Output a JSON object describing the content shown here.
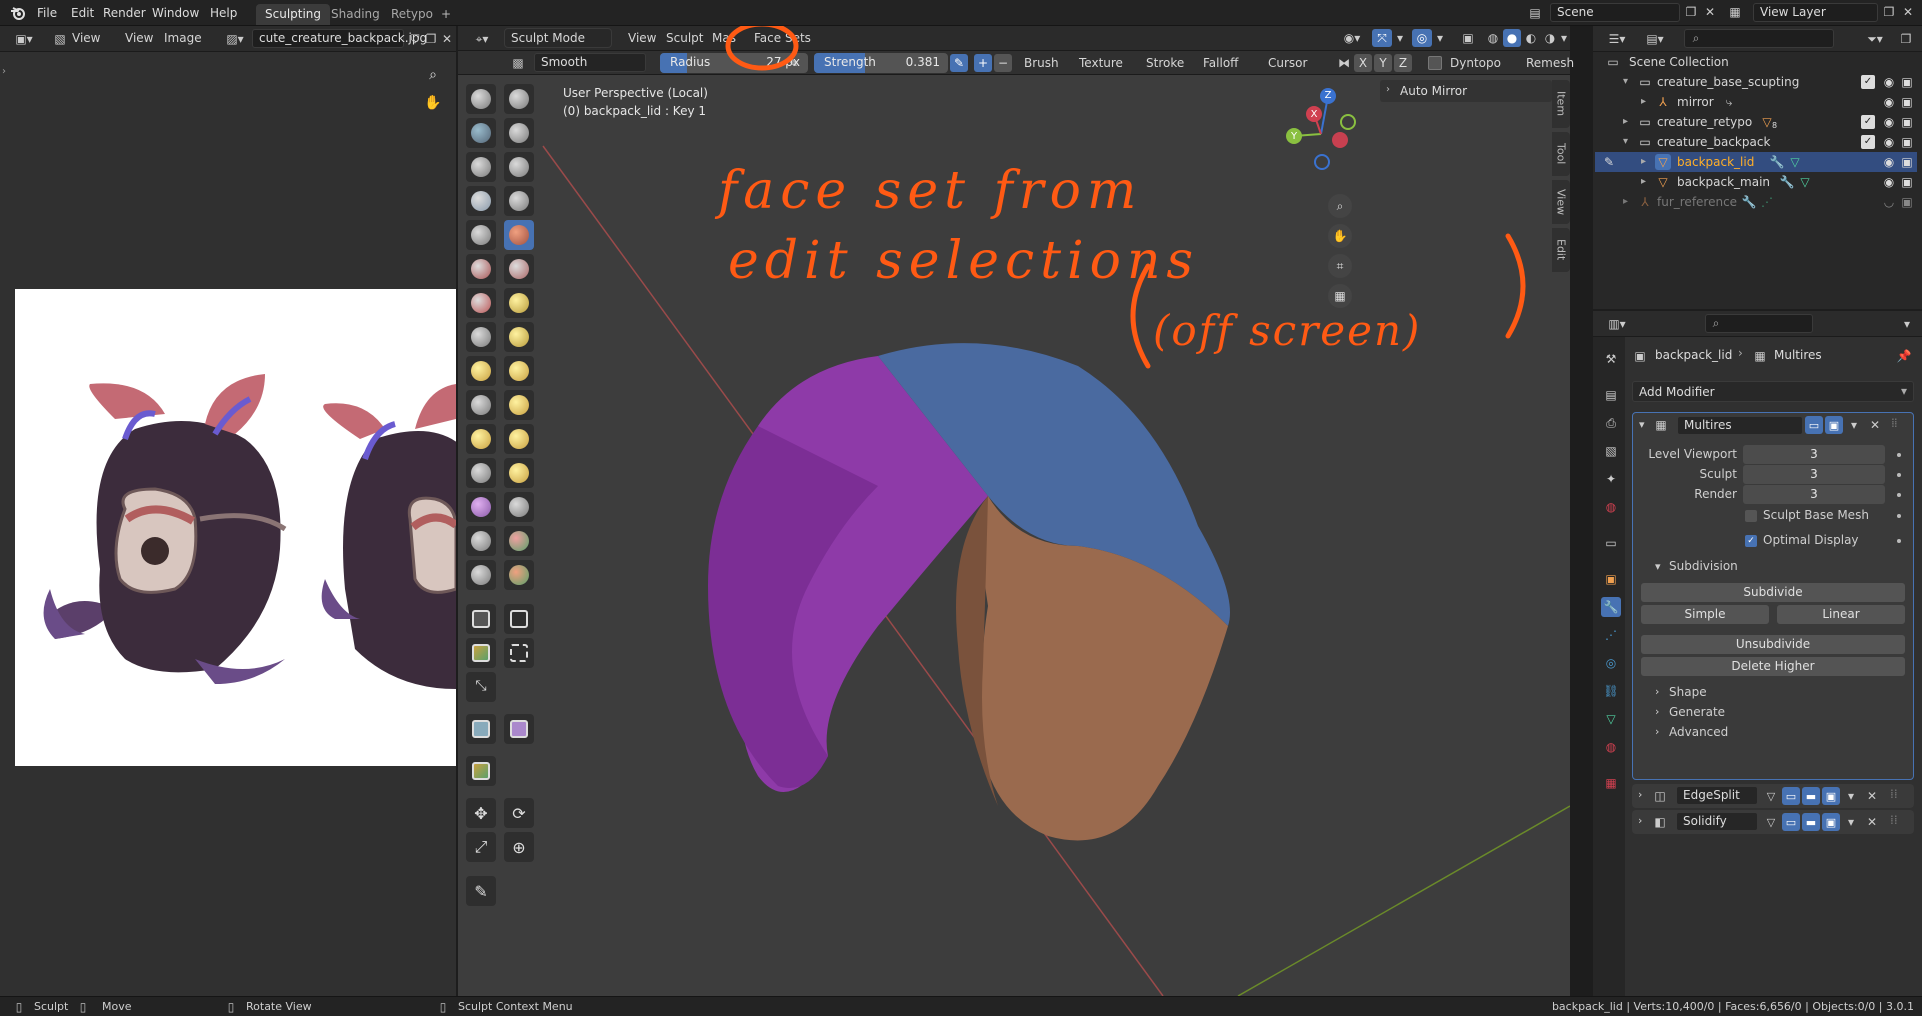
{
  "topbar": {
    "menus": [
      "File",
      "Edit",
      "Render",
      "Window",
      "Help"
    ],
    "workspaces": [
      "Sculpting",
      "Shading",
      "Retypo"
    ],
    "add_tab": "+",
    "scene_name": "Scene",
    "view_layer": "View Layer"
  },
  "image_editor": {
    "view_label": "View",
    "menus": [
      "View",
      "Image"
    ],
    "image_name": "cute_creature_backpack.jpg"
  },
  "viewport": {
    "mode": "Sculpt Mode",
    "menus": [
      "View",
      "Sculpt",
      "Mas",
      "Face Sets"
    ],
    "brush_name": "Smooth",
    "radius_label": "Radius",
    "radius_value": "27 px",
    "strength_label": "Strength",
    "strength_value": "0.381",
    "tool_menus": [
      "Brush",
      "Texture",
      "Stroke",
      "Falloff",
      "Cursor"
    ],
    "axes": [
      "X",
      "Y",
      "Z"
    ],
    "dyntopo": "Dyntopo",
    "remesh": "Remesh",
    "perspective": "User Perspective (Local)",
    "object_info": "(0) backpack_lid : Key 1",
    "auto_mirror": "Auto Mirror",
    "side_tabs": [
      "Item",
      "Tool",
      "View",
      "Edit"
    ],
    "gizmo": {
      "x": "X",
      "y": "Y",
      "z": "Z"
    },
    "annotation_lines": [
      "face set from",
      "edit selections",
      "(off screen)"
    ],
    "annotation_color": "#ff5a14"
  },
  "outliner": {
    "root": "Scene Collection",
    "rows": [
      {
        "label": "creature_base_scupting"
      },
      {
        "label": "mirror"
      },
      {
        "label": "creature_retypo"
      },
      {
        "label": "creature_backpack"
      },
      {
        "label": "backpack_lid"
      },
      {
        "label": "backpack_main"
      },
      {
        "label": "fur_reference"
      }
    ],
    "retypo_badge": "8"
  },
  "properties": {
    "breadcrumb_object": "backpack_lid",
    "breadcrumb_modifier": "Multires",
    "add_modifier": "Add Modifier",
    "modifier_name": "Multires",
    "fields": [
      {
        "label": "Level Viewport",
        "value": "3"
      },
      {
        "label": "Sculpt",
        "value": "3"
      },
      {
        "label": "Render",
        "value": "3"
      }
    ],
    "sculpt_base_mesh": "Sculpt Base Mesh",
    "optimal_display": "Optimal Display",
    "subdivision_header": "Subdivision",
    "subdivide": "Subdivide",
    "simple": "Simple",
    "linear": "Linear",
    "unsubdivide": "Unsubdivide",
    "delete_higher": "Delete Higher",
    "subpanels": [
      "Shape",
      "Generate",
      "Advanced"
    ],
    "other_modifiers": [
      "EdgeSplit",
      "Solidify"
    ]
  },
  "statusbar": {
    "left_items": [
      "Sculpt",
      "Move",
      "Rotate View",
      "Sculpt Context Menu"
    ],
    "stats": "backpack_lid | Verts:10,400/0 | Faces:6,656/0 | Objects:0/0 | 3.0.1"
  },
  "colors": {
    "accent_blue": "#4772b3",
    "face_purple": "#8e3aa8",
    "face_blue": "#4a6aa0",
    "face_brown": "#9a6a4e",
    "active_object": "#ffaf29"
  }
}
